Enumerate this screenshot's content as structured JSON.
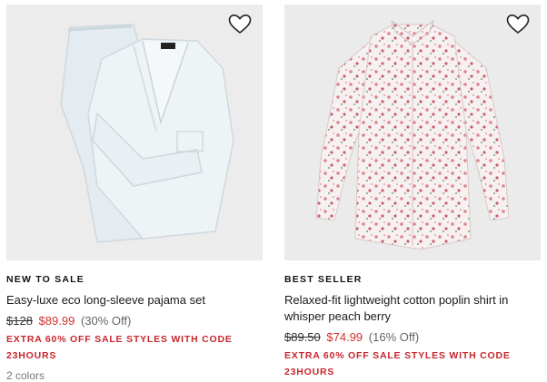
{
  "products": [
    {
      "badge": "NEW TO SALE",
      "title": "Easy-luxe eco long-sleeve pajama set",
      "original_price": "$128",
      "sale_price": "$89.99",
      "discount": "(30% Off)",
      "promo": "EXTRA 60% OFF SALE STYLES WITH CODE 23HOURS",
      "colors": "2 colors",
      "icon": "heart-outline-icon"
    },
    {
      "badge": "BEST SELLER",
      "title": "Relaxed-fit lightweight cotton poplin shirt in whisper peach berry",
      "original_price": "$89.50",
      "sale_price": "$74.99",
      "discount": "(16% Off)",
      "promo": "EXTRA 60% OFF SALE STYLES WITH CODE 23HOURS",
      "icon": "heart-outline-icon"
    }
  ],
  "colors": {
    "sale_red": "#d0312d",
    "promo_red": "#c8262c",
    "image_bg": "#ececec"
  }
}
